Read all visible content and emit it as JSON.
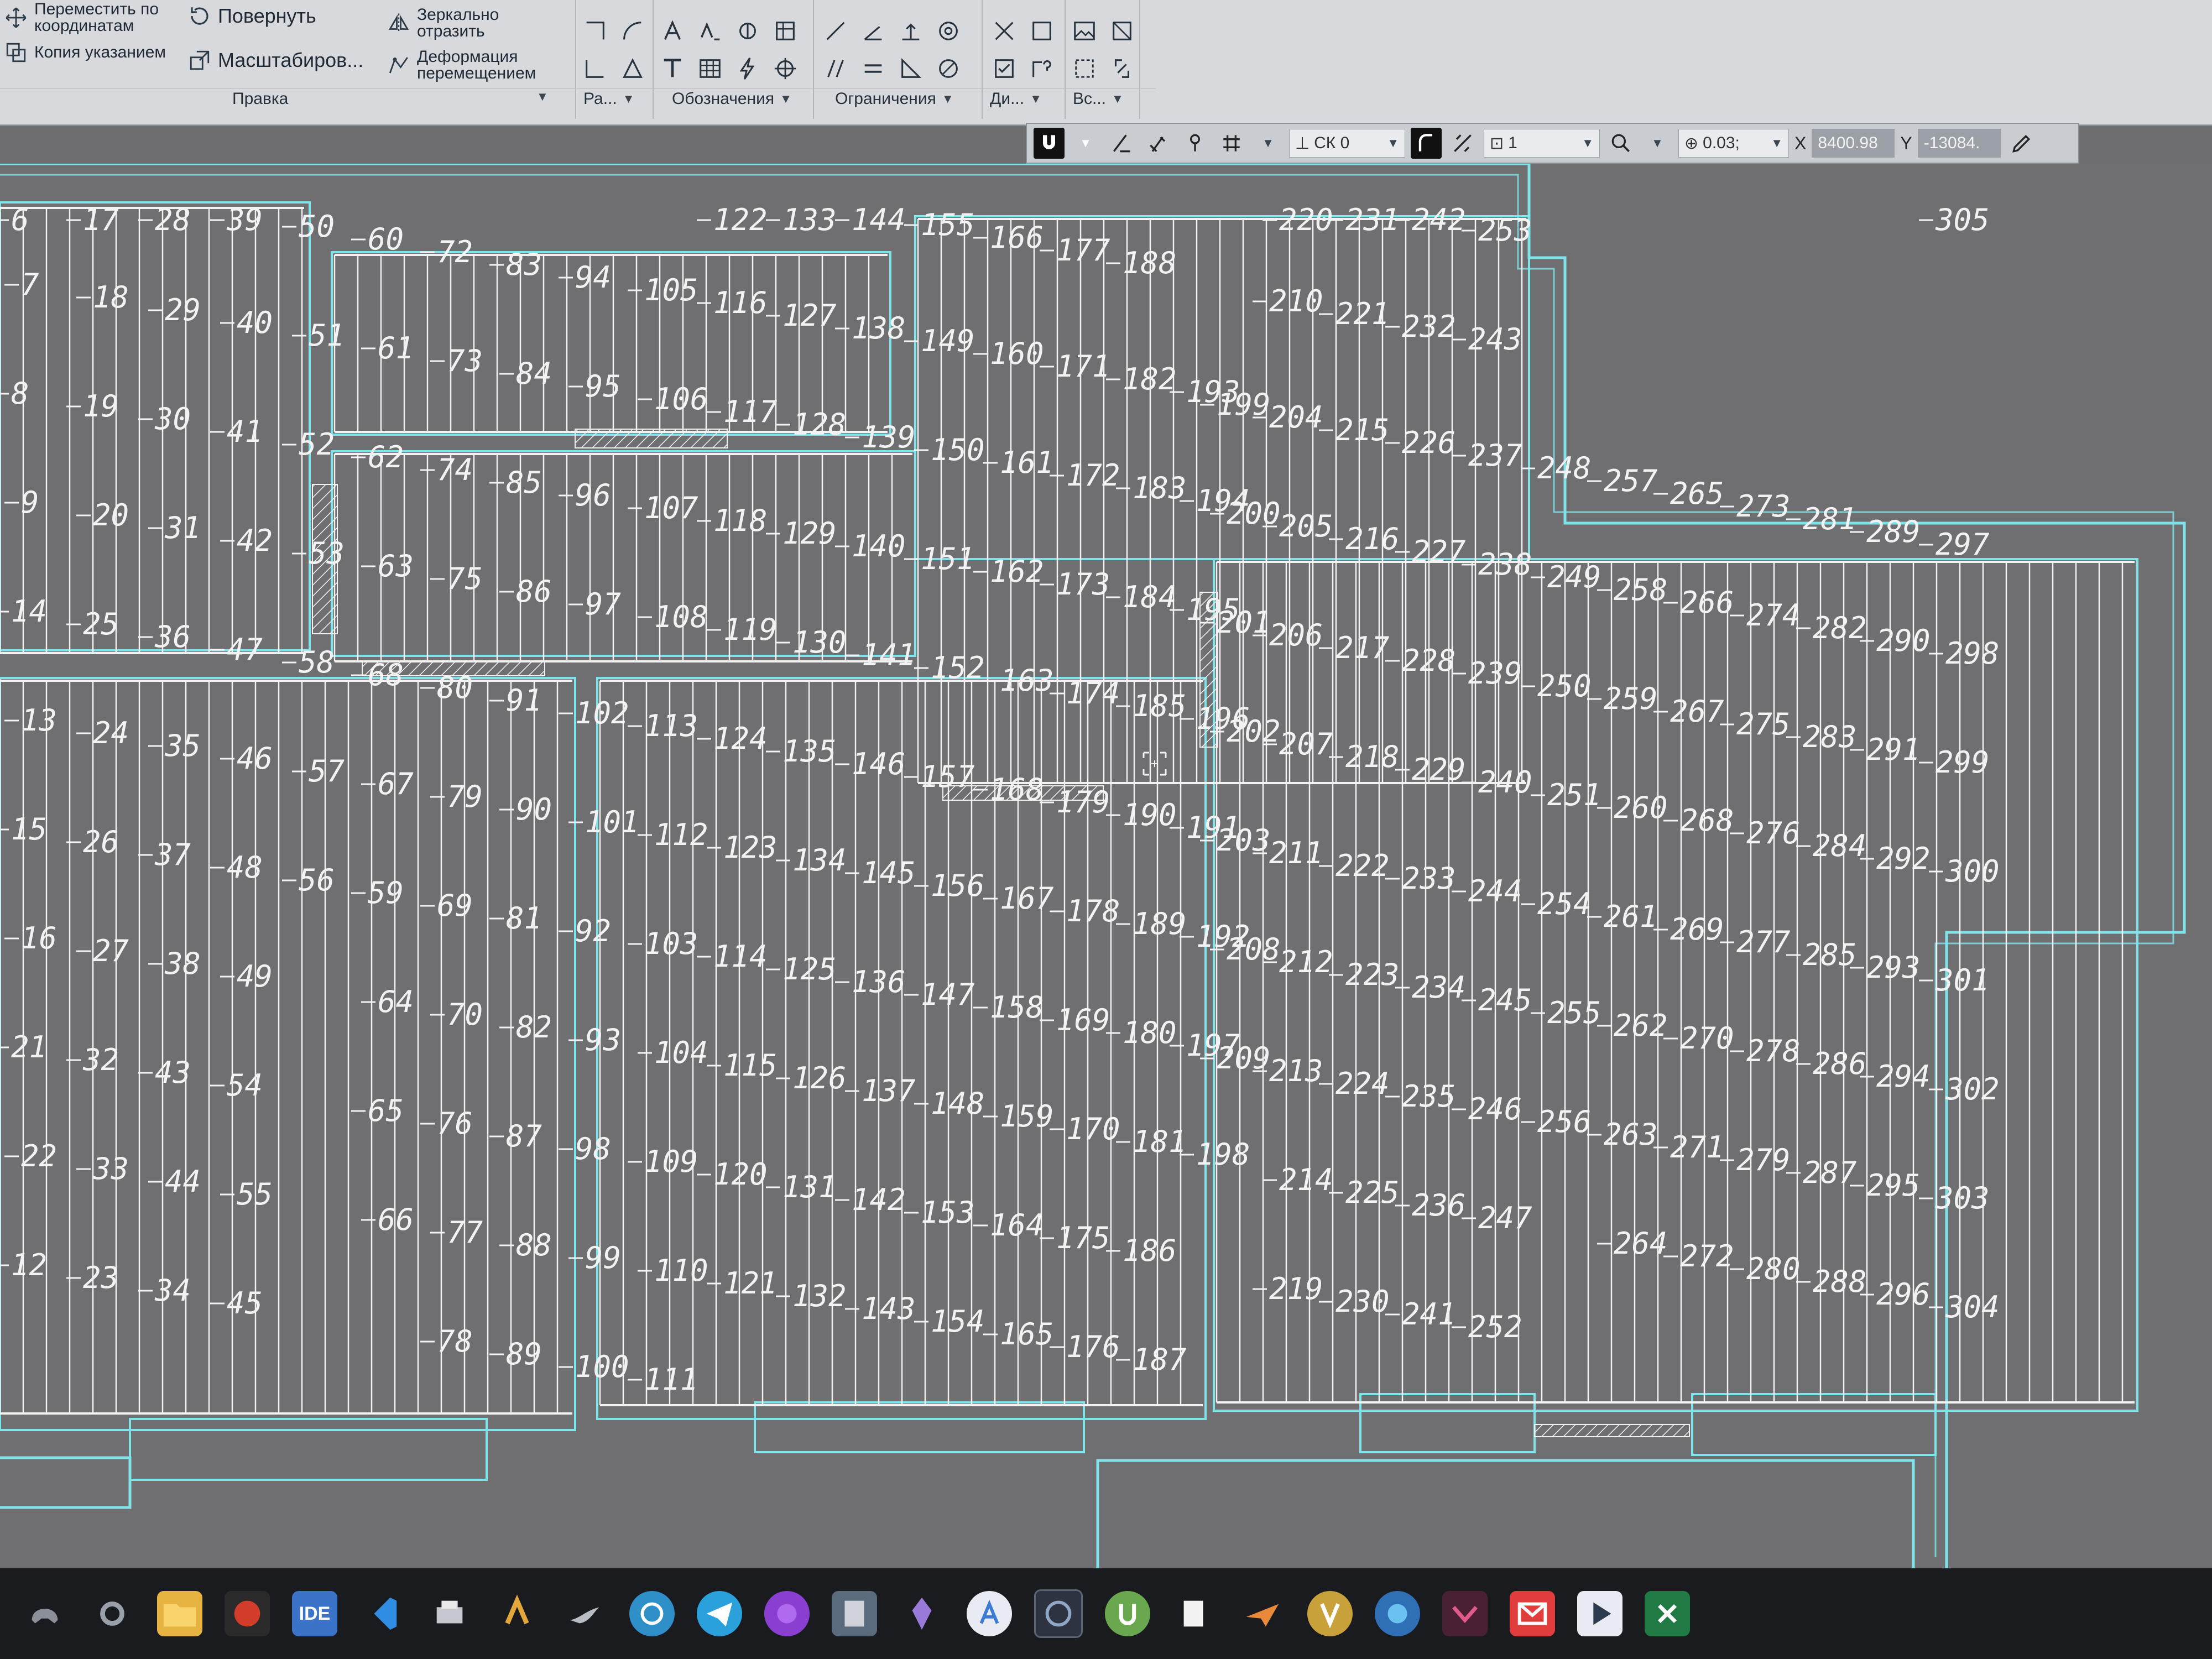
{
  "ribbon": {
    "items": {
      "move_coords": "Переместить по координатам",
      "copy_ptr": "Копия указанием",
      "rotate": "Повернуть",
      "scale": "Масштабиров...",
      "mirror": "Зеркально отразить",
      "deform": "Деформация перемещением"
    },
    "groups": [
      "Правка",
      "Ра...",
      "Обозначения",
      "Ограничения",
      "Ди...",
      "Вс..."
    ]
  },
  "snapbar": {
    "cs": "СК 0",
    "layer": "1",
    "zoom": "0.03;",
    "x_label": "X",
    "x_value": "8400.98",
    "y_label": "Y",
    "y_value": "-13084."
  },
  "plan": {
    "column_numbers": {
      "c0": [
        "6",
        "7",
        "8",
        "9",
        "14",
        "13",
        "15",
        "16",
        "21",
        "22",
        "12"
      ],
      "c1": [
        "17",
        "18",
        "19",
        "20",
        "25",
        "24",
        "26",
        "27",
        "32",
        "33",
        "23"
      ],
      "c2": [
        "28",
        "29",
        "30",
        "31",
        "36",
        "35",
        "37",
        "38",
        "43",
        "44",
        "34"
      ],
      "c3": [
        "39",
        "40",
        "41",
        "42",
        "47",
        "46",
        "48",
        "49",
        "54",
        "55",
        "45"
      ],
      "c4": [
        "50",
        "51",
        "52",
        "53",
        "58",
        "57",
        "56"
      ],
      "c5": [
        "60",
        "61",
        "62",
        "63",
        "68",
        "67",
        "59",
        "64",
        "65",
        "66"
      ],
      "c6": [
        "72",
        "73",
        "74",
        "75",
        "80",
        "79",
        "69",
        "70",
        "76",
        "77",
        "78"
      ],
      "c7": [
        "83",
        "84",
        "85",
        "86",
        "91",
        "90",
        "81",
        "82",
        "87",
        "88",
        "89"
      ],
      "c8": [
        "94",
        "95",
        "96",
        "97",
        "102",
        "101",
        "92",
        "93",
        "98",
        "99",
        "100"
      ],
      "c9": [
        "105",
        "106",
        "107",
        "108",
        "113",
        "112",
        "103",
        "104",
        "109",
        "110",
        "111"
      ],
      "c10": [
        "116",
        "117",
        "118",
        "119",
        "124",
        "123",
        "114",
        "115",
        "120",
        "121",
        "122"
      ],
      "c11": [
        "127",
        "128",
        "129",
        "130",
        "135",
        "134",
        "125",
        "126",
        "131",
        "132",
        "133"
      ],
      "c12": [
        "138",
        "139",
        "140",
        "141",
        "146",
        "145",
        "136",
        "137",
        "142",
        "143",
        "144"
      ],
      "c13": [
        "149",
        "150",
        "151",
        "152",
        "157",
        "156",
        "147",
        "148",
        "153",
        "154",
        "155"
      ],
      "c14": [
        "160",
        "161",
        "162",
        "163",
        "168",
        "167",
        "158",
        "159",
        "164",
        "165",
        "166"
      ],
      "c15": [
        "171",
        "172",
        "173",
        "174",
        "179",
        "178",
        "169",
        "170",
        "175",
        "176",
        "177"
      ],
      "c16": [
        "182",
        "183",
        "184",
        "185",
        "190",
        "189",
        "180",
        "181",
        "186",
        "187",
        "188"
      ],
      "c17": [
        "193",
        "194",
        "195",
        "196",
        "191",
        "192",
        "197",
        "198"
      ],
      "c18": [
        "199",
        "200",
        "201",
        "202",
        "203",
        "208",
        "209"
      ],
      "c19": [
        "204",
        "205",
        "206",
        "207",
        "211",
        "212",
        "213",
        "214",
        "219",
        "220",
        "210"
      ],
      "c20": [
        "215",
        "216",
        "217",
        "218",
        "222",
        "223",
        "224",
        "225",
        "230",
        "231",
        "221"
      ],
      "c21": [
        "226",
        "227",
        "228",
        "229",
        "233",
        "234",
        "235",
        "236",
        "241",
        "242",
        "232"
      ],
      "c22": [
        "237",
        "238",
        "239",
        "240",
        "244",
        "245",
        "246",
        "247",
        "252",
        "253",
        "243"
      ],
      "c23": [
        "248",
        "249",
        "250",
        "251",
        "254",
        "255",
        "256"
      ],
      "c24": [
        "257",
        "258",
        "259",
        "260",
        "261",
        "262",
        "263",
        "264"
      ],
      "c25": [
        "265",
        "266",
        "267",
        "268",
        "269",
        "270",
        "271",
        "272"
      ],
      "c26": [
        "273",
        "274",
        "275",
        "276",
        "277",
        "278",
        "279",
        "280"
      ],
      "c27": [
        "281",
        "282",
        "283",
        "284",
        "285",
        "286",
        "287",
        "288"
      ],
      "c28": [
        "289",
        "290",
        "291",
        "292",
        "293",
        "294",
        "295",
        "296"
      ],
      "c29": [
        "297",
        "298",
        "299",
        "300",
        "301",
        "302",
        "303",
        "304",
        "305"
      ]
    }
  },
  "taskbar": {
    "ide_label": "IDE"
  },
  "colors": {
    "canvas_bg": "#6f6f72",
    "outline_cyan": "#7fe3ea",
    "board_line": "#f2f2f2",
    "ribbon_bg": "#d7d9dc"
  }
}
